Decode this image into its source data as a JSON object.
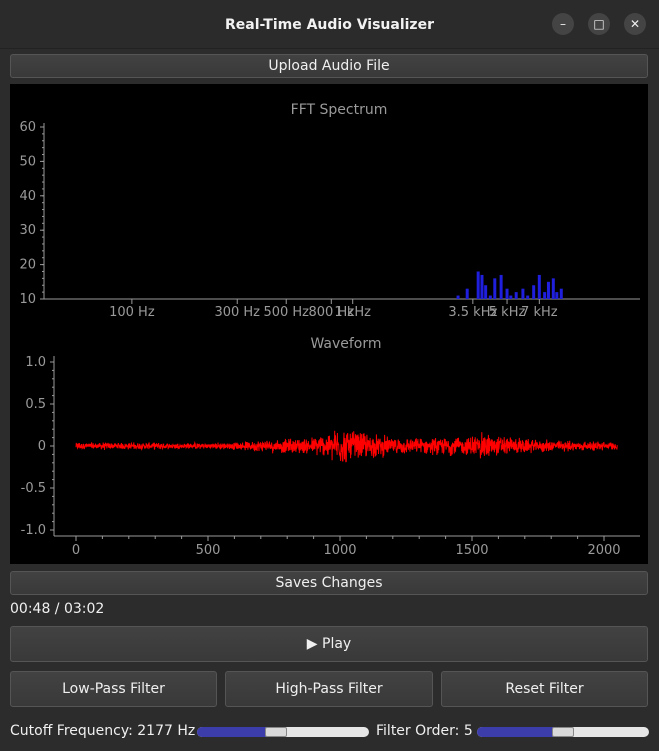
{
  "window": {
    "title": "Real-Time Audio Visualizer",
    "minimize_icon": "minimize-icon",
    "maximize_icon": "maximize-icon",
    "close_icon": "close-icon"
  },
  "upload_button": "Upload Audio File",
  "fft": {
    "title": "FFT Spectrum",
    "y_ticks": [
      "60",
      "50",
      "40",
      "30",
      "20",
      "10"
    ],
    "x_ticks": [
      "100 Hz",
      "300 Hz",
      "500 Hz",
      "800 Hz",
      "1 kHz",
      "3.5 kHz",
      "5 kHz",
      "7 kHz"
    ],
    "bar_color": "#1f1fdd"
  },
  "waveform": {
    "title": "Waveform",
    "y_ticks": [
      "1.0",
      "0.5",
      "0",
      "-0.5",
      "-1.0"
    ],
    "x_ticks": [
      "0",
      "500",
      "1000",
      "1500",
      "2000"
    ],
    "line_color": "#ff0000"
  },
  "chart_data": [
    {
      "type": "bar",
      "title": "FFT Spectrum",
      "xlabel": "",
      "ylabel": "",
      "ylim": [
        10,
        60
      ],
      "x_scale": "log",
      "x_tick_labels": [
        "100 Hz",
        "300 Hz",
        "500 Hz",
        "800 Hz",
        "1 kHz",
        "3.5 kHz",
        "5 kHz",
        "7 kHz"
      ],
      "y_tick_labels": [
        "10",
        "20",
        "30",
        "40",
        "50",
        "60"
      ],
      "x": [
        3000,
        3300,
        3700,
        3850,
        4000,
        4200,
        4400,
        4700,
        5000,
        5200,
        5500,
        5900,
        6200,
        6600,
        7000,
        7400,
        7700,
        8100,
        8400,
        8800
      ],
      "values": [
        11,
        13,
        18,
        17,
        14,
        11,
        16,
        17,
        13,
        11,
        12,
        13,
        11,
        14,
        17,
        12,
        15,
        16,
        12,
        13
      ],
      "grid": false,
      "legend": "none"
    },
    {
      "type": "line",
      "title": "Waveform",
      "xlabel": "",
      "ylabel": "",
      "xlim": [
        0,
        2050
      ],
      "ylim": [
        -1.0,
        1.0
      ],
      "x_tick_labels": [
        "0",
        "500",
        "1000",
        "1500",
        "2000"
      ],
      "y_tick_labels": [
        "-1.0",
        "-0.5",
        "0",
        "0.5",
        "1.0"
      ],
      "envelope_x": [
        0,
        200,
        400,
        600,
        700,
        800,
        900,
        1000,
        1100,
        1200,
        1300,
        1400,
        1500,
        1550,
        1600,
        1700,
        1800,
        1900,
        2000,
        2050
      ],
      "envelope_amplitude": [
        0.05,
        0.05,
        0.04,
        0.05,
        0.08,
        0.1,
        0.12,
        0.25,
        0.18,
        0.12,
        0.1,
        0.12,
        0.14,
        0.2,
        0.15,
        0.1,
        0.08,
        0.07,
        0.06,
        0.05
      ],
      "grid": false,
      "legend": "none"
    }
  ],
  "save_button": "Saves Changes",
  "time_display": "00:48 / 03:02",
  "play_button": "▶ Play",
  "filter_buttons": {
    "low_pass": "Low-Pass Filter",
    "high_pass": "High-Pass Filter",
    "reset": "Reset Filter"
  },
  "cutoff": {
    "label": "Cutoff Frequency: 2177 Hz",
    "level": 0.45
  },
  "order": {
    "label": "Filter Order: 5",
    "level": 0.5
  },
  "colors": {
    "slider_fill": "#3c3caa",
    "slider_track": "#e6e6e6",
    "plot_bg": "#000000"
  }
}
